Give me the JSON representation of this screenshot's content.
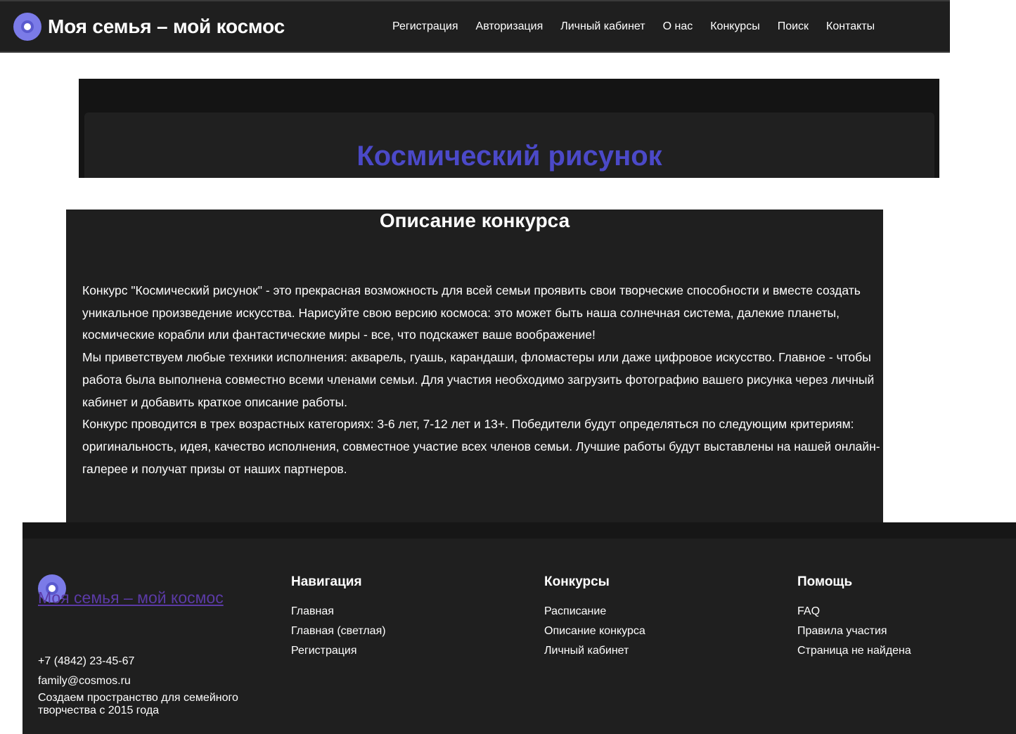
{
  "header": {
    "brand": "Моя семья – мой космос",
    "nav": [
      "Регистрация",
      "Авторизация",
      "Личный кабинет",
      "О нас",
      "Конкурсы",
      "Поиск",
      "Контакты"
    ]
  },
  "hero": {
    "title": "Космический рисунок"
  },
  "description": {
    "heading": "Описание конкурса",
    "paragraphs": [
      "Конкурс \"Космический рисунок\" - это прекрасная возможность для всей семьи проявить свои творческие способности и вместе создать уникальное произведение искусства. Нарисуйте свою версию космоса: это может быть наша солнечная система, далекие планеты, космические корабли или фантастические миры - все, что подскажет ваше воображение!",
      "Мы приветствуем любые техники исполнения: акварель, гуашь, карандаши, фломастеры или даже цифровое искусство. Главное - чтобы работа была выполнена совместно всеми членами семьи. Для участия необходимо загрузить фотографию вашего рисунка через личный кабинет и добавить краткое описание работы.",
      "Конкурс проводится в трех возрастных категориях: 3-6 лет, 7-12 лет и 13+. Победители будут определяться по следующим критериям: оригинальность, идея, качество исполнения, совместное участие всех членов семьи. Лучшие работы будут выставлены на нашей онлайн-галерее и получат призы от наших партнеров."
    ]
  },
  "footer": {
    "brand": " Моя семья – мой космос",
    "phone": "+7 (4842) 23-45-67",
    "email": "family@cosmos.ru",
    "about": "Создаем пространство для семейного творчества с 2015 года",
    "columns": [
      {
        "title": "Навигация",
        "links": [
          "Главная",
          "Главная (светлая)",
          "Регистрация"
        ]
      },
      {
        "title": "Конкурсы",
        "links": [
          "Расписание",
          "Описание конкурса",
          "Личный кабинет"
        ]
      },
      {
        "title": "Помощь",
        "links": [
          "FAQ",
          "Правила участия",
          "Страница не найдена"
        ]
      }
    ]
  },
  "colors": {
    "accent": "#4b49c8",
    "logo": "#7b7be8",
    "footer_link": "#5b3aa6",
    "dark_bg": "#1f1f1f"
  }
}
